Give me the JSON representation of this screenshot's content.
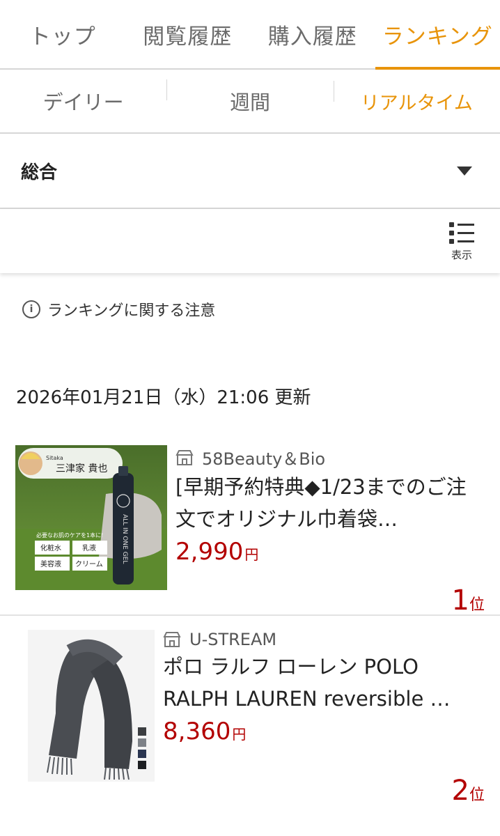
{
  "tabs": [
    "トップ",
    "閲覧履歴",
    "購入履歴",
    "ランキング"
  ],
  "subtabs": [
    "デイリー",
    "週間",
    "リアルタイム"
  ],
  "category": {
    "label": "総合"
  },
  "toolbar": {
    "view_label": "表示"
  },
  "notice": {
    "text": "ランキングに関する注意"
  },
  "updated": {
    "text": "2026年01月21日（水）21:06 更新"
  },
  "items": [
    {
      "shop": "58Beauty＆Bio",
      "title": "[早期予約特典◆1/23までのご注文でオリジナル巾着袋…",
      "price": "2,990",
      "price_unit": "円",
      "rank": "1",
      "rank_unit": "位",
      "image_text": {
        "brand": "Sitaka",
        "name": "三津家 貴也",
        "bottle": "ALL IN ONE GEL",
        "cells": [
          "化粧水",
          "乳液",
          "美容液",
          "クリーム"
        ],
        "caption": "必要なお肌のケアを1本に!"
      }
    },
    {
      "shop": "U-STREAM",
      "title": "ポロ ラルフ ローレン POLO RALPH LAUREN reversible …",
      "price": "8,360",
      "price_unit": "円",
      "rank": "2",
      "rank_unit": "位"
    }
  ],
  "colors": {
    "accent": "#e8940a",
    "price": "#b30000"
  }
}
